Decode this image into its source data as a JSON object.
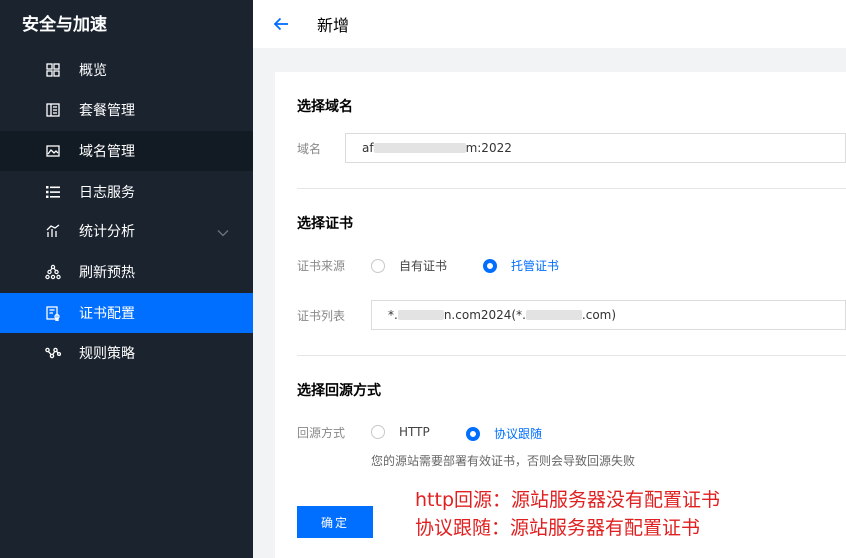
{
  "sidebar": {
    "title": "安全与加速",
    "items": [
      {
        "label": "概览",
        "icon": "grid-icon"
      },
      {
        "label": "套餐管理",
        "icon": "package-icon"
      },
      {
        "label": "域名管理",
        "icon": "domain-icon"
      },
      {
        "label": "日志服务",
        "icon": "list-icon"
      },
      {
        "label": "统计分析",
        "icon": "chart-icon"
      },
      {
        "label": "刷新预热",
        "icon": "tree-icon"
      },
      {
        "label": "证书配置",
        "icon": "certificate-icon"
      },
      {
        "label": "规则策略",
        "icon": "rules-icon"
      }
    ]
  },
  "header": {
    "title": "新增"
  },
  "form": {
    "domain_section_title": "选择域名",
    "domain_label": "域名",
    "domain_value_prefix": "af",
    "domain_value_suffix": "m:2022",
    "cert_section_title": "选择证书",
    "cert_source_label": "证书来源",
    "cert_source_options": [
      "自有证书",
      "托管证书"
    ],
    "cert_source_selected": "托管证书",
    "cert_list_label": "证书列表",
    "cert_value_a": "*.",
    "cert_value_b": "n.com2024(*.",
    "cert_value_c": ".com)",
    "origin_section_title": "选择回源方式",
    "origin_label": "回源方式",
    "origin_options": [
      "HTTP",
      "协议跟随"
    ],
    "origin_selected": "协议跟随",
    "origin_hint": "您的源站需要部署有效证书，否则会导致回源失败",
    "confirm_label": "确定"
  },
  "annotations": [
    "http回源：源站服务器没有配置证书",
    "协议跟随：源站服务器有配置证书"
  ],
  "colors": {
    "sidebar_bg": "#1b232f",
    "sidebar_active": "#006eff",
    "accent": "#006eff",
    "annotation": "#e02020"
  }
}
